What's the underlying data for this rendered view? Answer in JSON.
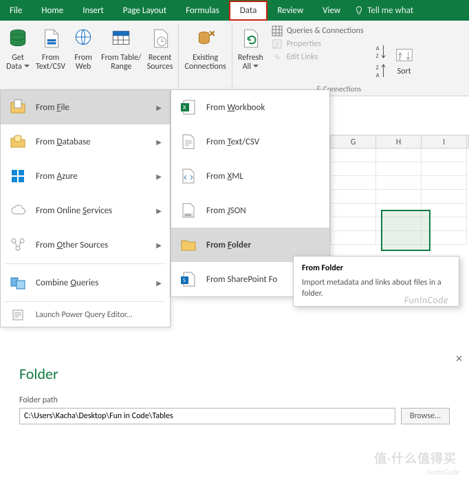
{
  "menubar": {
    "tabs": [
      "File",
      "Home",
      "Insert",
      "Page Layout",
      "Formulas",
      "Data",
      "Review",
      "View"
    ],
    "active_index": 5,
    "tell_me": "Tell me what"
  },
  "ribbon": {
    "get_data": "Get\nData",
    "from_text": "From\nText/CSV",
    "from_web": "From\nWeb",
    "from_table": "From Table/\nRange",
    "recent": "Recent\nSources",
    "existing": "Existing\nConnections",
    "refresh": "Refresh\nAll",
    "queries": "Queries & Connections",
    "properties": "Properties",
    "edit_links": "Edit Links",
    "sort": "Sort",
    "group_label": "& Connections"
  },
  "dd1": {
    "items": [
      {
        "label": "From File",
        "u": "F"
      },
      {
        "label": "From Database",
        "u": "D"
      },
      {
        "label": "From Azure",
        "u": "A"
      },
      {
        "label": "From Online Services",
        "u": "S"
      },
      {
        "label": "From Other Sources",
        "u": "O"
      },
      {
        "label": "Combine Queries",
        "u": "Q"
      }
    ],
    "launch": "Launch Power Query Editor...",
    "hover_index": 0
  },
  "dd2": {
    "items": [
      {
        "label": "From Workbook",
        "u": "W"
      },
      {
        "label": "From Text/CSV",
        "u": "T"
      },
      {
        "label": "From XML",
        "u": "X"
      },
      {
        "label": "From JSON",
        "u": "J"
      },
      {
        "label": "From Folder",
        "u": "F"
      },
      {
        "label": "From SharePoint Folder",
        "u": "S",
        "trunc": "From SharePoint Fo"
      }
    ],
    "hover_index": 4
  },
  "tooltip": {
    "title": "From Folder",
    "body": "Import metadata and links about files in a folder."
  },
  "sheet": {
    "cols": [
      "G",
      "H",
      "I"
    ]
  },
  "dialog": {
    "title": "Folder",
    "label": "Folder path",
    "path": "C:\\Users\\Kacha\\Desktop\\Fun in Code\\Tables",
    "browse": "Browse..."
  },
  "watermarks": {
    "w1": "FunInCode",
    "w2": "值·什么值得买",
    "w3": "FunInCode"
  }
}
